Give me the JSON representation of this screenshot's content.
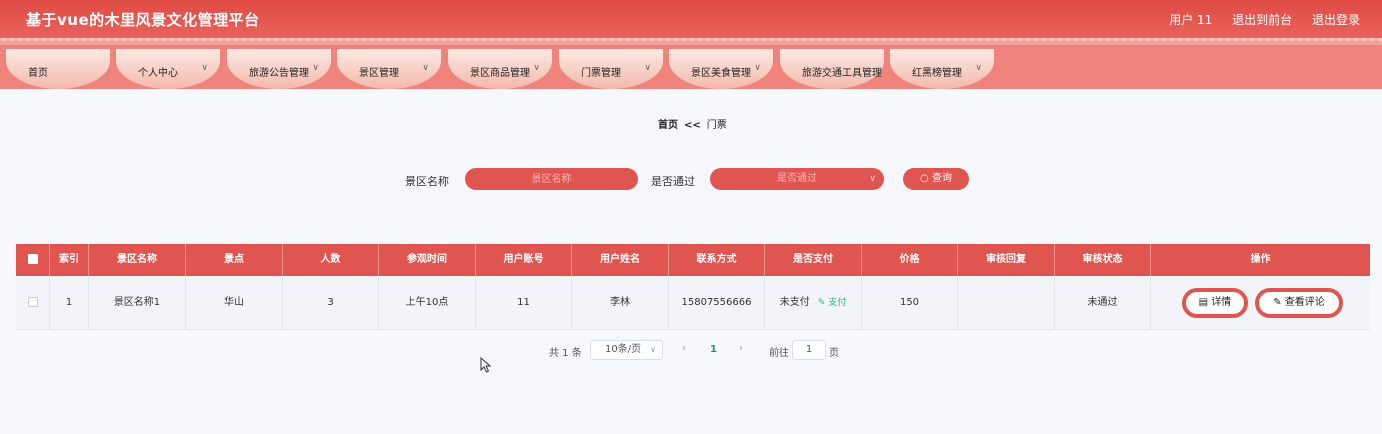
{
  "header": {
    "title": "基于vue的木里风景文化管理平台",
    "user": "用户 11",
    "back_front": "退出到前台",
    "logout": "退出登录"
  },
  "nav": [
    {
      "label": "首页",
      "chev": false
    },
    {
      "label": "个人中心",
      "chev": true
    },
    {
      "label": "旅游公告管理",
      "chev": true
    },
    {
      "label": "景区管理",
      "chev": true
    },
    {
      "label": "景区商品管理",
      "chev": true
    },
    {
      "label": "门票管理",
      "chev": true
    },
    {
      "label": "景区美食管理",
      "chev": true
    },
    {
      "label": "旅游交通工具管理",
      "chev": false
    },
    {
      "label": "红黑榜管理",
      "chev": true
    }
  ],
  "breadcrumb": {
    "home": "首页",
    "sep": "<<",
    "current": "门票"
  },
  "search": {
    "name_label": "景区名称",
    "name_placeholder": "景区名称",
    "pass_label": "是否通过",
    "pass_placeholder": "是否通过",
    "query_label": "查询"
  },
  "table": {
    "headers": [
      "索引",
      "景区名称",
      "景点",
      "人数",
      "参观时间",
      "用户账号",
      "用户姓名",
      "联系方式",
      "是否支付",
      "价格",
      "审核回复",
      "审核状态",
      "操作"
    ],
    "rows": [
      {
        "index": "1",
        "scenic_name": "景区名称1",
        "spot": "华山",
        "count": "3",
        "visit_time": "上午10点",
        "account": "11",
        "user_name": "李林",
        "phone": "15807556666",
        "paid": "未支付",
        "pay_action": "支付",
        "price": "150",
        "reply": "",
        "status": "未通过",
        "detail_label": "详情",
        "comment_label": "查看评论"
      }
    ]
  },
  "pagination": {
    "total": "共 1 条",
    "page_size": "10条/页",
    "current_page": "1",
    "goto_label": "前往",
    "goto_value": "1",
    "page_suffix": "页"
  },
  "colors": {
    "primary": "#e05550",
    "success": "#2bb673"
  }
}
